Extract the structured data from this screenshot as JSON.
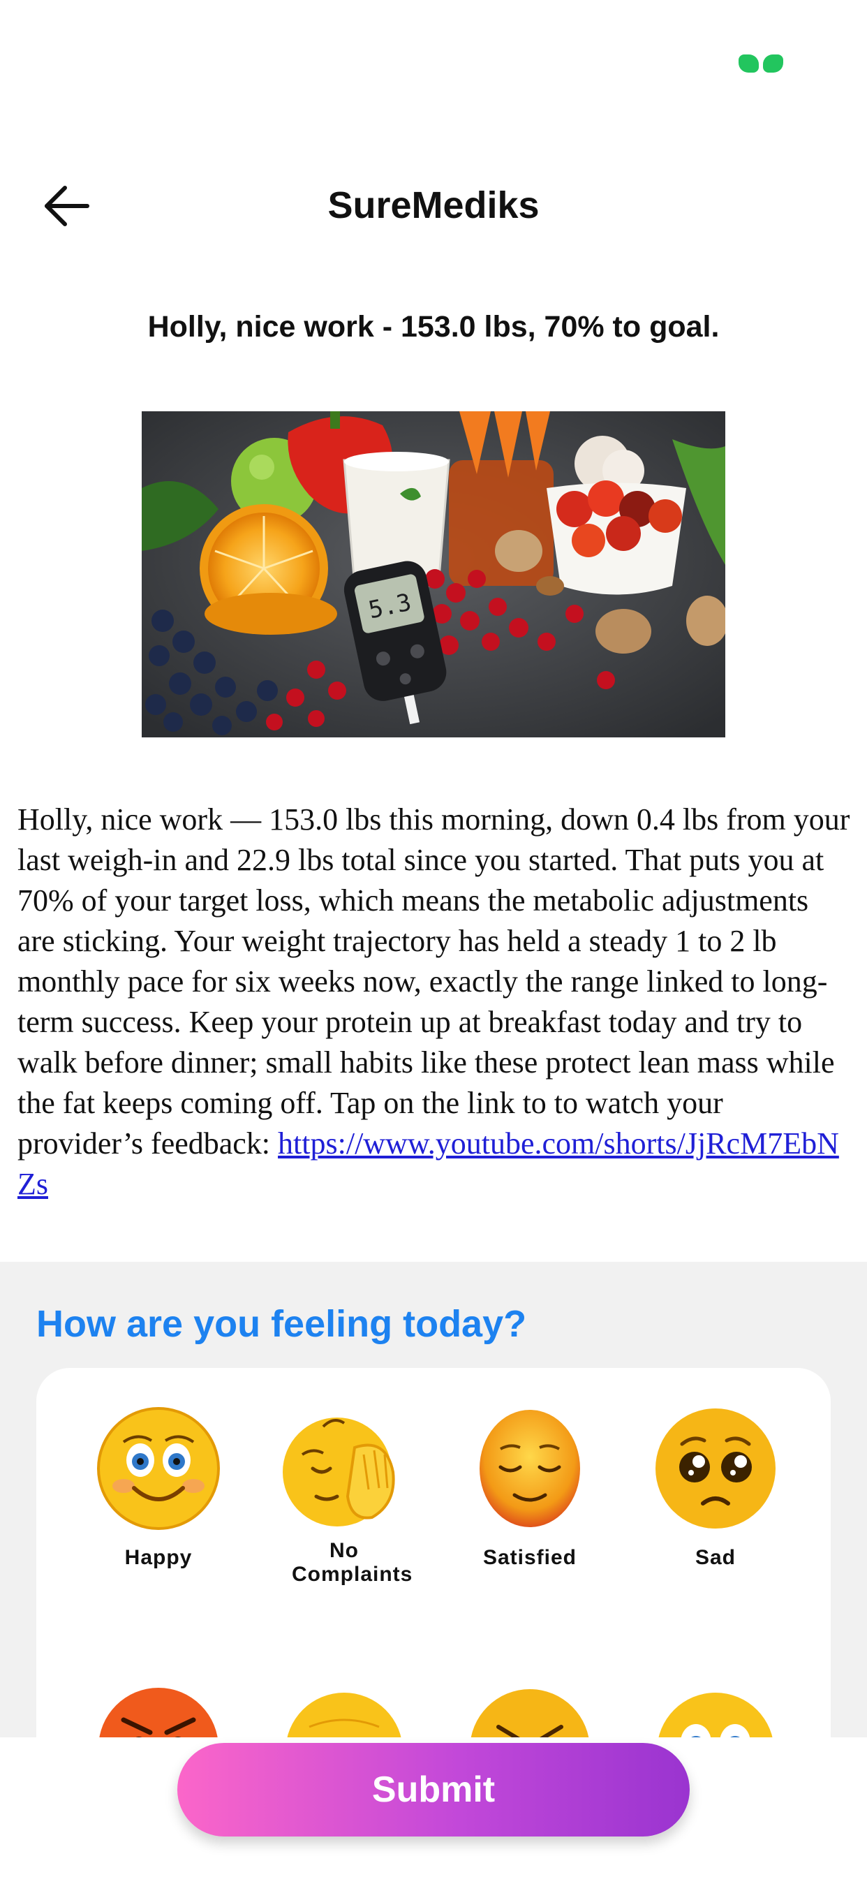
{
  "header": {
    "title": "SureMediks",
    "back_icon": "arrow-left-icon"
  },
  "headline": "Holly, nice work - 153.0 lbs, 70% to goal.",
  "hero_image": {
    "icon": "healthy-food-glucose-meter-photo",
    "meter_reading": "5.3"
  },
  "message": {
    "text": "Holly, nice work — 153.0 lbs this morning, down 0.4 lbs from your last weigh-in and 22.9 lbs total since you started. That puts you at 70% of your target loss, which means the metabolic adjustments are sticking. Your weight trajectory has held a steady 1 to 2 lb monthly pace for six weeks now, exactly the range linked to long-term success. Keep your protein up at breakfast today and try to walk before dinner; small habits like these protect lean mass while the fat keeps coming off. Tap on the link to to watch your provider’s feedback: ",
    "link": "https://www.youtube.com/shorts/JjRcM7EbNZs"
  },
  "feeling": {
    "title": "How are you feeling today?",
    "moods": [
      {
        "label": "Happy",
        "icon": "happy-emoji-icon"
      },
      {
        "label": "No Complaints",
        "icon": "no-complaints-emoji-icon"
      },
      {
        "label": "Satisfied",
        "icon": "satisfied-emoji-icon"
      },
      {
        "label": "Sad",
        "icon": "sad-emoji-icon"
      },
      {
        "label": "",
        "icon": "angry-emoji-icon"
      },
      {
        "label": "",
        "icon": "neutral-emoji-icon"
      },
      {
        "label": "",
        "icon": "frustrated-emoji-icon"
      },
      {
        "label": "",
        "icon": "worried-emoji-icon"
      }
    ]
  },
  "submit": {
    "label": "Submit"
  },
  "colors": {
    "accent_blue": "#1d82f0",
    "submit_gradient_start": "#fb66c9",
    "submit_gradient_end": "#9a34d0",
    "status_green": "#22c55e"
  }
}
